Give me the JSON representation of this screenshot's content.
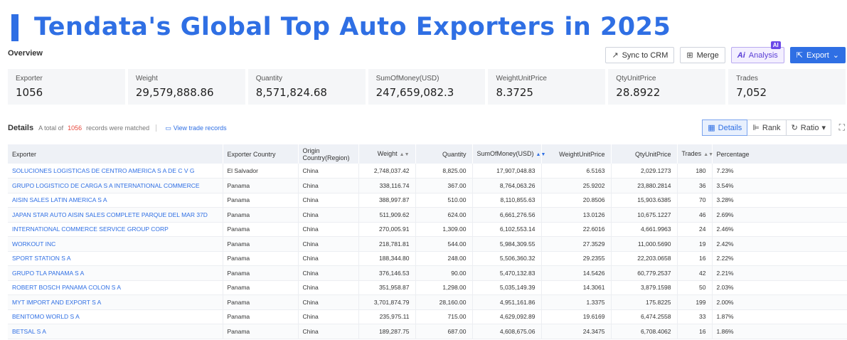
{
  "title": "Tendata's Global Top Auto Exporters in 2025",
  "overview_label": "Overview",
  "toolbar": {
    "sync_label": "Sync to CRM",
    "merge_label": "Merge",
    "analysis_label": "Analysis",
    "analysis_badge": "AI",
    "analysis_icon_text": "Ai",
    "export_label": "Export"
  },
  "stats": [
    {
      "label": "Exporter",
      "value": "1056"
    },
    {
      "label": "Weight",
      "value": "29,579,888.86"
    },
    {
      "label": "Quantity",
      "value": "8,571,824.68"
    },
    {
      "label": "SumOfMoney(USD)",
      "value": "247,659,082.3"
    },
    {
      "label": "WeightUnitPrice",
      "value": "8.3725"
    },
    {
      "label": "QtyUnitPrice",
      "value": "28.8922"
    },
    {
      "label": "Trades",
      "value": "7,052"
    }
  ],
  "details": {
    "label": "Details",
    "total_prefix": "A total of",
    "count": "1056",
    "total_suffix": "records were matched",
    "view_link": "View trade records"
  },
  "view_tabs": {
    "details": "Details",
    "rank": "Rank",
    "ratio": "Ratio"
  },
  "table": {
    "headers": {
      "exporter": "Exporter",
      "country": "Exporter Country",
      "origin": "Origin Country(Region)",
      "weight": "Weight",
      "quantity": "Quantity",
      "money": "SumOfMoney(USD)",
      "wup": "WeightUnitPrice",
      "qup": "QtyUnitPrice",
      "trades": "Trades",
      "pct": "Percentage"
    },
    "rows": [
      [
        "SOLUCIONES LOGISTICAS DE CENTRO AMERICA S A DE C V G",
        "El Salvador",
        "China",
        "2,748,037.42",
        "8,825.00",
        "17,907,048.83",
        "6.5163",
        "2,029.1273",
        "180",
        "7.23%"
      ],
      [
        "GRUPO LOGISTICO DE CARGA S A INTERNATIONAL COMMERCE",
        "Panama",
        "China",
        "338,116.74",
        "367.00",
        "8,764,063.26",
        "25.9202",
        "23,880.2814",
        "36",
        "3.54%"
      ],
      [
        "AISIN SALES LATIN AMERICA S A",
        "Panama",
        "China",
        "388,997.87",
        "510.00",
        "8,110,855.63",
        "20.8506",
        "15,903.6385",
        "70",
        "3.28%"
      ],
      [
        "JAPAN STAR AUTO AISIN SALES COMPLETE PARQUE DEL MAR 37D",
        "Panama",
        "China",
        "511,909.62",
        "624.00",
        "6,661,276.56",
        "13.0126",
        "10,675.1227",
        "46",
        "2.69%"
      ],
      [
        "INTERNATIONAL COMMERCE SERVICE GROUP CORP",
        "Panama",
        "China",
        "270,005.91",
        "1,309.00",
        "6,102,553.14",
        "22.6016",
        "4,661.9963",
        "24",
        "2.46%"
      ],
      [
        "WORKOUT INC",
        "Panama",
        "China",
        "218,781.81",
        "544.00",
        "5,984,309.55",
        "27.3529",
        "11,000.5690",
        "19",
        "2.42%"
      ],
      [
        "SPORT STATION S A",
        "Panama",
        "China",
        "188,344.80",
        "248.00",
        "5,506,360.32",
        "29.2355",
        "22,203.0658",
        "16",
        "2.22%"
      ],
      [
        "GRUPO TLA PANAMA S A",
        "Panama",
        "China",
        "376,146.53",
        "90.00",
        "5,470,132.83",
        "14.5426",
        "60,779.2537",
        "42",
        "2.21%"
      ],
      [
        "ROBERT BOSCH PANAMA COLON S A",
        "Panama",
        "China",
        "351,958.87",
        "1,298.00",
        "5,035,149.39",
        "14.3061",
        "3,879.1598",
        "50",
        "2.03%"
      ],
      [
        "MYT IMPORT AND EXPORT S A",
        "Panama",
        "China",
        "3,701,874.79",
        "28,160.00",
        "4,951,161.86",
        "1.3375",
        "175.8225",
        "199",
        "2.00%"
      ],
      [
        "BENITOMO WORLD S A",
        "Panama",
        "China",
        "235,975.11",
        "715.00",
        "4,629,092.89",
        "19.6169",
        "6,474.2558",
        "33",
        "1.87%"
      ],
      [
        "BETSAL S A",
        "Panama",
        "China",
        "189,287.75",
        "687.00",
        "4,608,675.06",
        "24.3475",
        "6,708.4062",
        "16",
        "1.86%"
      ]
    ]
  }
}
